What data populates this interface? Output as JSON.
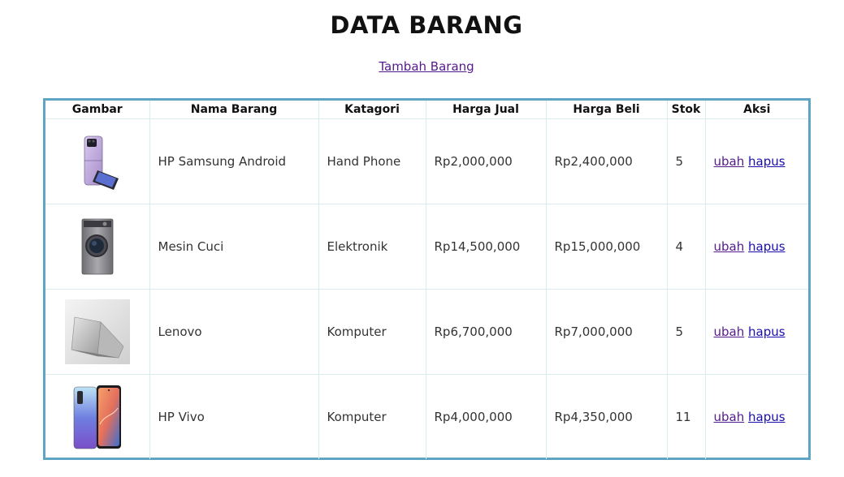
{
  "page": {
    "title": "DATA BARANG",
    "add_link": "Tambah Barang"
  },
  "table": {
    "headers": [
      "Gambar",
      "Nama Barang",
      "Katagori",
      "Harga Jual",
      "Harga Beli",
      "Stok",
      "Aksi"
    ],
    "rows": [
      {
        "image": "samsung-flip-phone-image",
        "name": "HP Samsung Android",
        "category": "Hand Phone",
        "sell_price": "Rp2,000,000",
        "buy_price": "Rp2,400,000",
        "stock": "5",
        "edit": "ubah",
        "delete": "hapus"
      },
      {
        "image": "washing-machine-image",
        "name": "Mesin Cuci",
        "category": "Elektronik",
        "sell_price": "Rp14,500,000",
        "buy_price": "Rp15,000,000",
        "stock": "4",
        "edit": "ubah",
        "delete": "hapus"
      },
      {
        "image": "lenovo-laptop-image",
        "name": "Lenovo",
        "category": "Komputer",
        "sell_price": "Rp6,700,000",
        "buy_price": "Rp7,000,000",
        "stock": "5",
        "edit": "ubah",
        "delete": "hapus"
      },
      {
        "image": "vivo-phone-image",
        "name": "HP Vivo",
        "category": "Komputer",
        "sell_price": "Rp4,000,000",
        "buy_price": "Rp4,350,000",
        "stock": "11",
        "edit": "ubah",
        "delete": "hapus"
      }
    ]
  },
  "colors": {
    "table_border": "#5ea5c4",
    "cell_border": "#d9ecef",
    "visited_link": "#551a8b",
    "link": "#1a0dab"
  }
}
